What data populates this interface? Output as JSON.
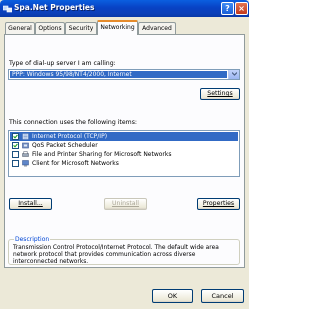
{
  "window": {
    "title": "Spa.Net Properties",
    "help_glyph": "?",
    "close_glyph": "×"
  },
  "tabs": [
    "General",
    "Options",
    "Security",
    "Networking",
    "Advanced"
  ],
  "active_tab": "Networking",
  "dialup": {
    "label": "Type of dial-up server I am calling:",
    "selected": "PPP: Windows 95/98/NT4/2000, Internet",
    "settings_button": "Settings"
  },
  "components": {
    "label": "This connection uses the following items:",
    "items": [
      {
        "label": "Internet Protocol (TCP/IP)",
        "checked": true,
        "selected": true,
        "icon": "network-protocol-icon"
      },
      {
        "label": "QoS Packet Scheduler",
        "checked": true,
        "selected": false,
        "icon": "network-service-icon"
      },
      {
        "label": "File and Printer Sharing for Microsoft Networks",
        "checked": false,
        "selected": false,
        "icon": "printer-sharing-icon"
      },
      {
        "label": "Client for Microsoft Networks",
        "checked": false,
        "selected": false,
        "icon": "network-client-icon"
      }
    ],
    "install_button": "Install...",
    "uninstall_button": "Uninstall",
    "properties_button": "Properties"
  },
  "description": {
    "title": "Description",
    "text": "Transmission Control Protocol/Internet Protocol. The default wide area network protocol that provides communication across diverse interconnected networks."
  },
  "footer": {
    "ok_button": "OK",
    "cancel_button": "Cancel"
  },
  "colors": {
    "titlebar": "#0a5fe0",
    "selection": "#316ac5",
    "dialog_bg": "#ece9d8",
    "tab_accent": "#e68b2c"
  }
}
